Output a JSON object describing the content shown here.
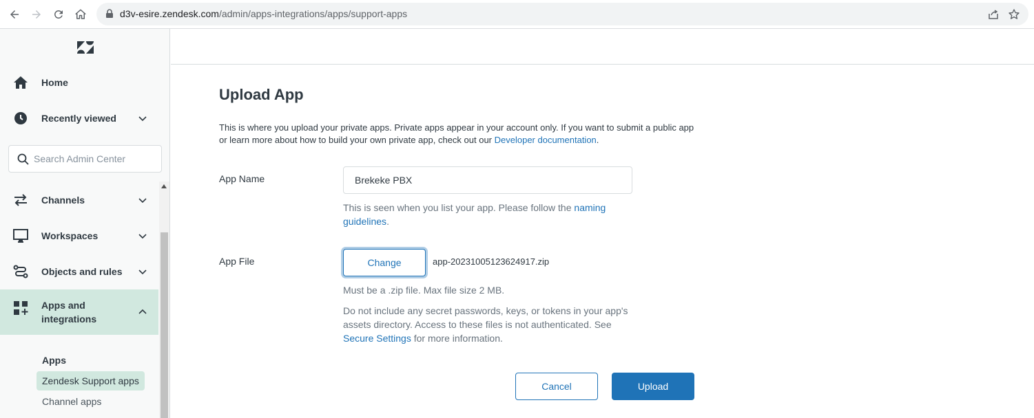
{
  "browser": {
    "url_host": "d3v-esire.zendesk.com",
    "url_path": "/admin/apps-integrations/apps/support-apps"
  },
  "sidebar": {
    "home": "Home",
    "recently_viewed": "Recently viewed",
    "search_placeholder": "Search Admin Center",
    "channels": "Channels",
    "workspaces": "Workspaces",
    "objects_and_rules": "Objects and rules",
    "apps_and_integrations_line1": "Apps and",
    "apps_and_integrations_line2": "integrations",
    "apps_heading": "Apps",
    "zendesk_support_apps": "Zendesk Support apps",
    "channel_apps": "Channel apps"
  },
  "main": {
    "title": "Upload App",
    "intro": "This is where you upload your private apps. Private apps appear in your account only. If you want to submit a public app or learn more about how to build your own private app, check out our ",
    "intro_link": "Developer documentation",
    "intro_end": ".",
    "app_name_label": "App Name",
    "app_name_value": "Brekeke PBX",
    "app_name_hint": "This is seen when you list your app. Please follow the ",
    "naming_link": "naming guidelines",
    "app_name_hint_end": ".",
    "app_file_label": "App File",
    "change_button": "Change",
    "file_name": "app-20231005123624917.zip",
    "file_hint": "Must be a .zip file. Max file size 2 MB.",
    "secret_hint": "Do not include any secret passwords, keys, or tokens in your app's assets directory. Access to these files is not authenticated. See ",
    "secure_link": "Secure Settings",
    "secret_hint_end": " for more information.",
    "cancel_button": "Cancel",
    "upload_button": "Upload"
  },
  "colors": {
    "accent": "#1f73b7",
    "sidebar_active": "#d1e8df"
  }
}
